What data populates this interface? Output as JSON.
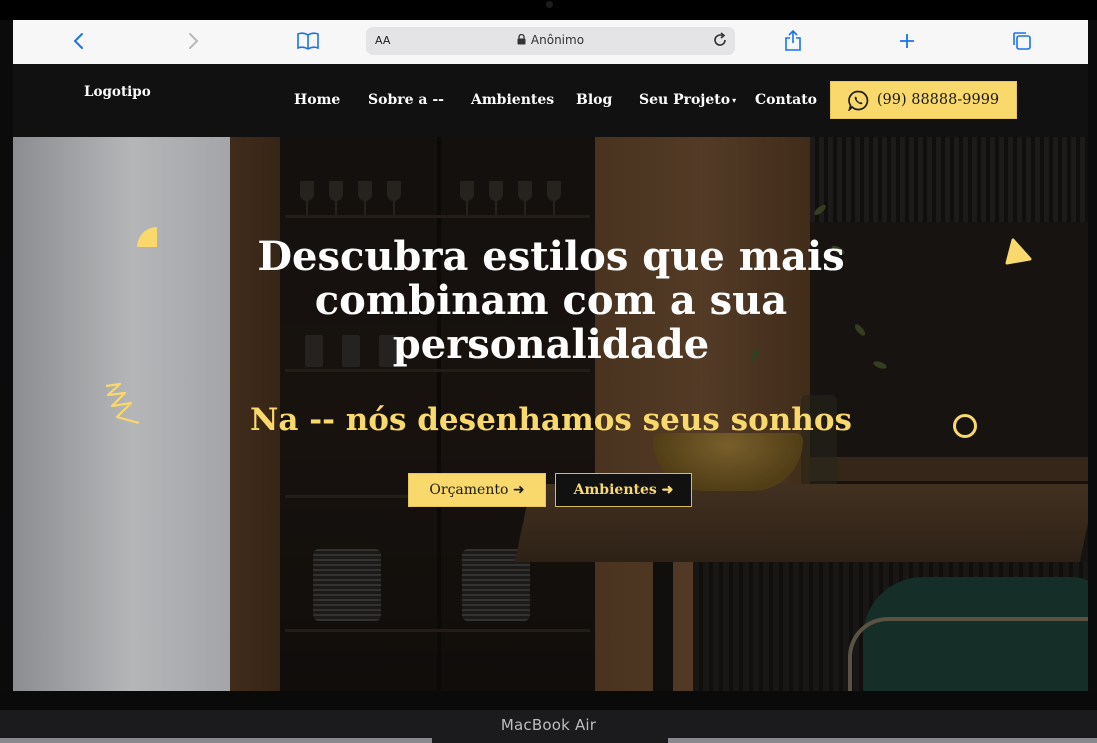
{
  "device": {
    "label": "MacBook Air"
  },
  "browser": {
    "text_size_label": "AA",
    "address_text": "Anônimo"
  },
  "site": {
    "logo": "Logotipo",
    "nav": [
      {
        "label": "Home"
      },
      {
        "label": "Sobre a --"
      },
      {
        "label": "Ambientes"
      },
      {
        "label": "Blog"
      },
      {
        "label": "Seu Projeto"
      },
      {
        "label": "Contato"
      }
    ],
    "phone_button": "(99) 88888-9999"
  },
  "hero": {
    "title": "Descubra estilos que mais combinam com a sua personalidade",
    "subtitle": "Na -- nós desenhamos seus sonhos",
    "primary_button": "Orçamento ➜",
    "secondary_button": "Ambientes ➜"
  },
  "colors": {
    "accent": "#f9d86c",
    "header_bg": "#111111",
    "toolbar_bg": "#f7f7f7",
    "browser_icon_blue": "#1a73e8"
  },
  "icons": {
    "back": "chevron-left-icon",
    "forward": "chevron-right-icon",
    "bookmarks": "book-icon",
    "lock": "lock-icon",
    "reload": "reload-icon",
    "share": "share-icon",
    "new_tab": "plus-icon",
    "tabs": "tabs-icon",
    "whatsapp": "whatsapp-icon"
  }
}
